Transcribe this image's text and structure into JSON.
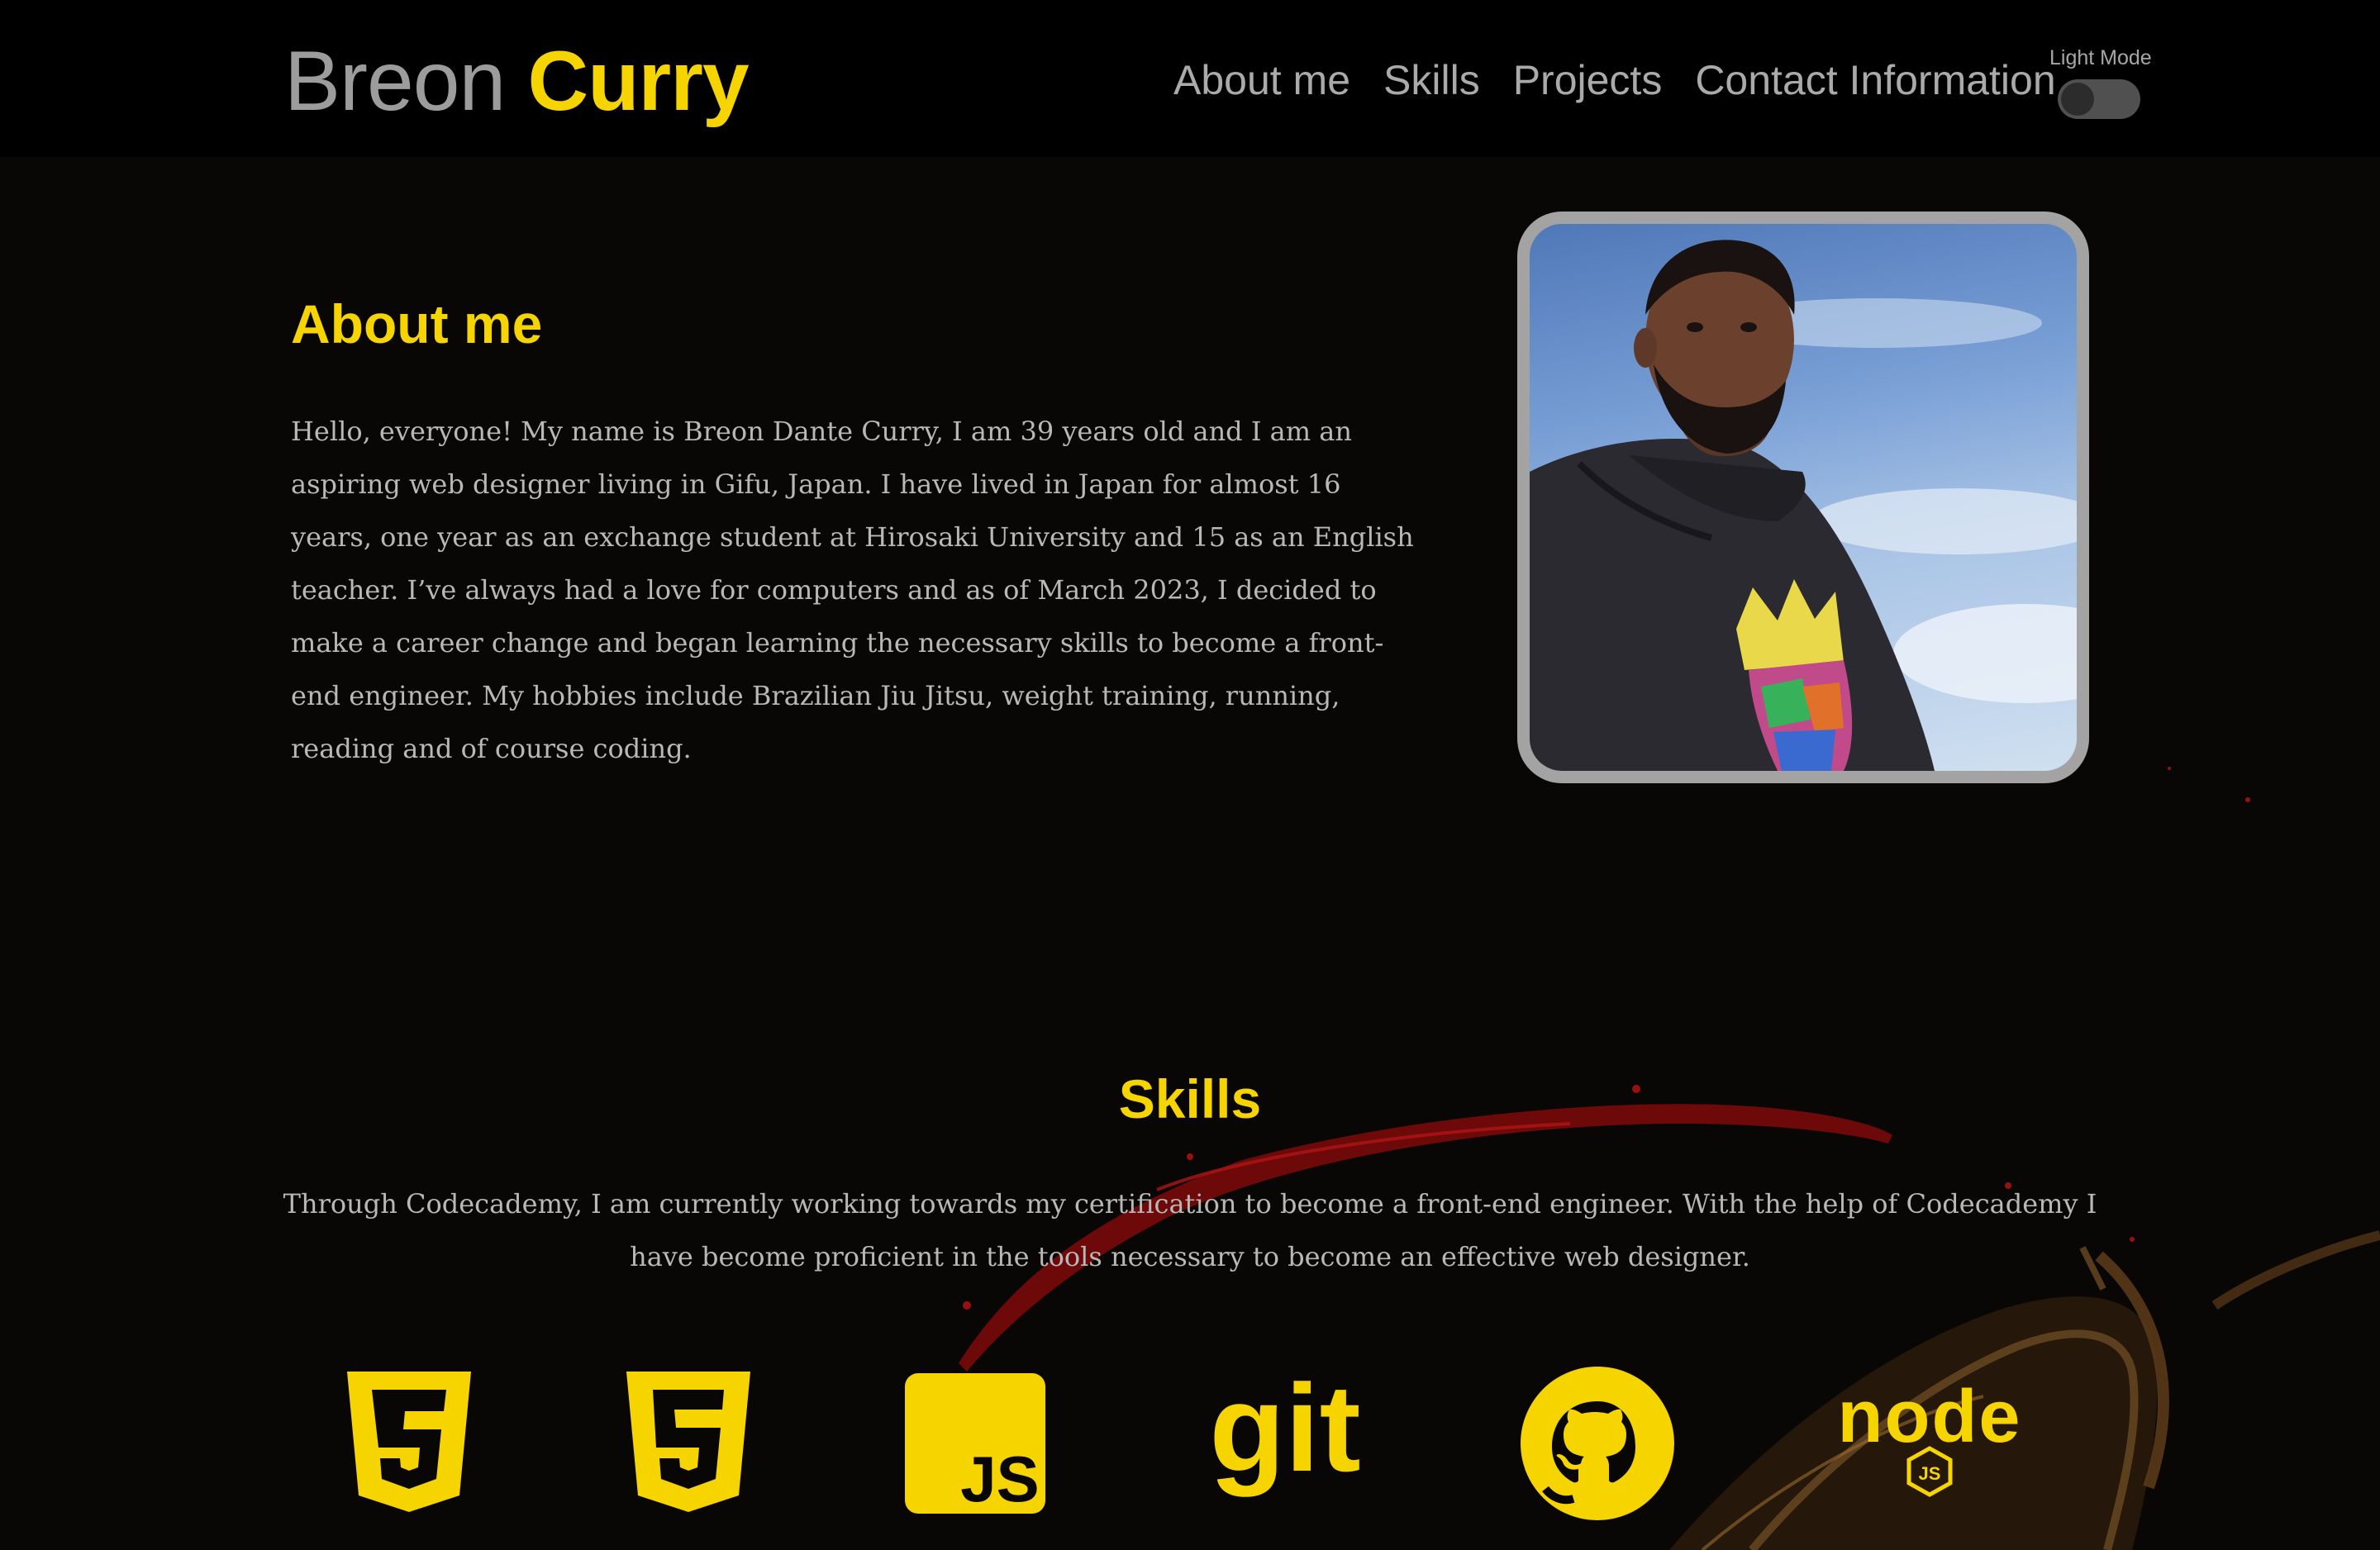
{
  "header": {
    "brand_first": "Breon",
    "brand_last": "Curry",
    "nav": [
      "About me",
      "Skills",
      "Projects",
      "Contact Information"
    ],
    "mode_label": "Light Mode"
  },
  "about": {
    "heading": "About me",
    "text": "Hello, everyone! My name is Breon Dante Curry, I am 39 years old and I am an aspiring web designer living in Gifu, Japan. I have lived in Japan for almost 16 years, one year as an exchange student at Hirosaki University and 15 as an English teacher. I’ve always had a love for computers and as of March 2023, I decided to make a career change and began learning the necessary skills to become a front-end engineer. My hobbies include Brazilian Jiu Jitsu, weight training, running, reading and of course coding."
  },
  "skills": {
    "heading": "Skills",
    "text": "Through Codecademy, I am currently working towards my certification to become a front-end engineer. With the help of Codecademy I have become proficient in the tools necessary to become an effective web designer.",
    "icons": [
      "css3-icon",
      "html5-icon",
      "javascript-icon",
      "git-icon",
      "github-icon",
      "nodejs-icon"
    ],
    "icon_texts": {
      "js": "JS",
      "git": "git",
      "node": "node",
      "node_js": "JS"
    }
  },
  "colors": {
    "accent": "#f5d400",
    "nav_text": "#aaaaaa",
    "body_text": "#b8b8b8",
    "background": "#090705",
    "header_bg": "#000000"
  }
}
